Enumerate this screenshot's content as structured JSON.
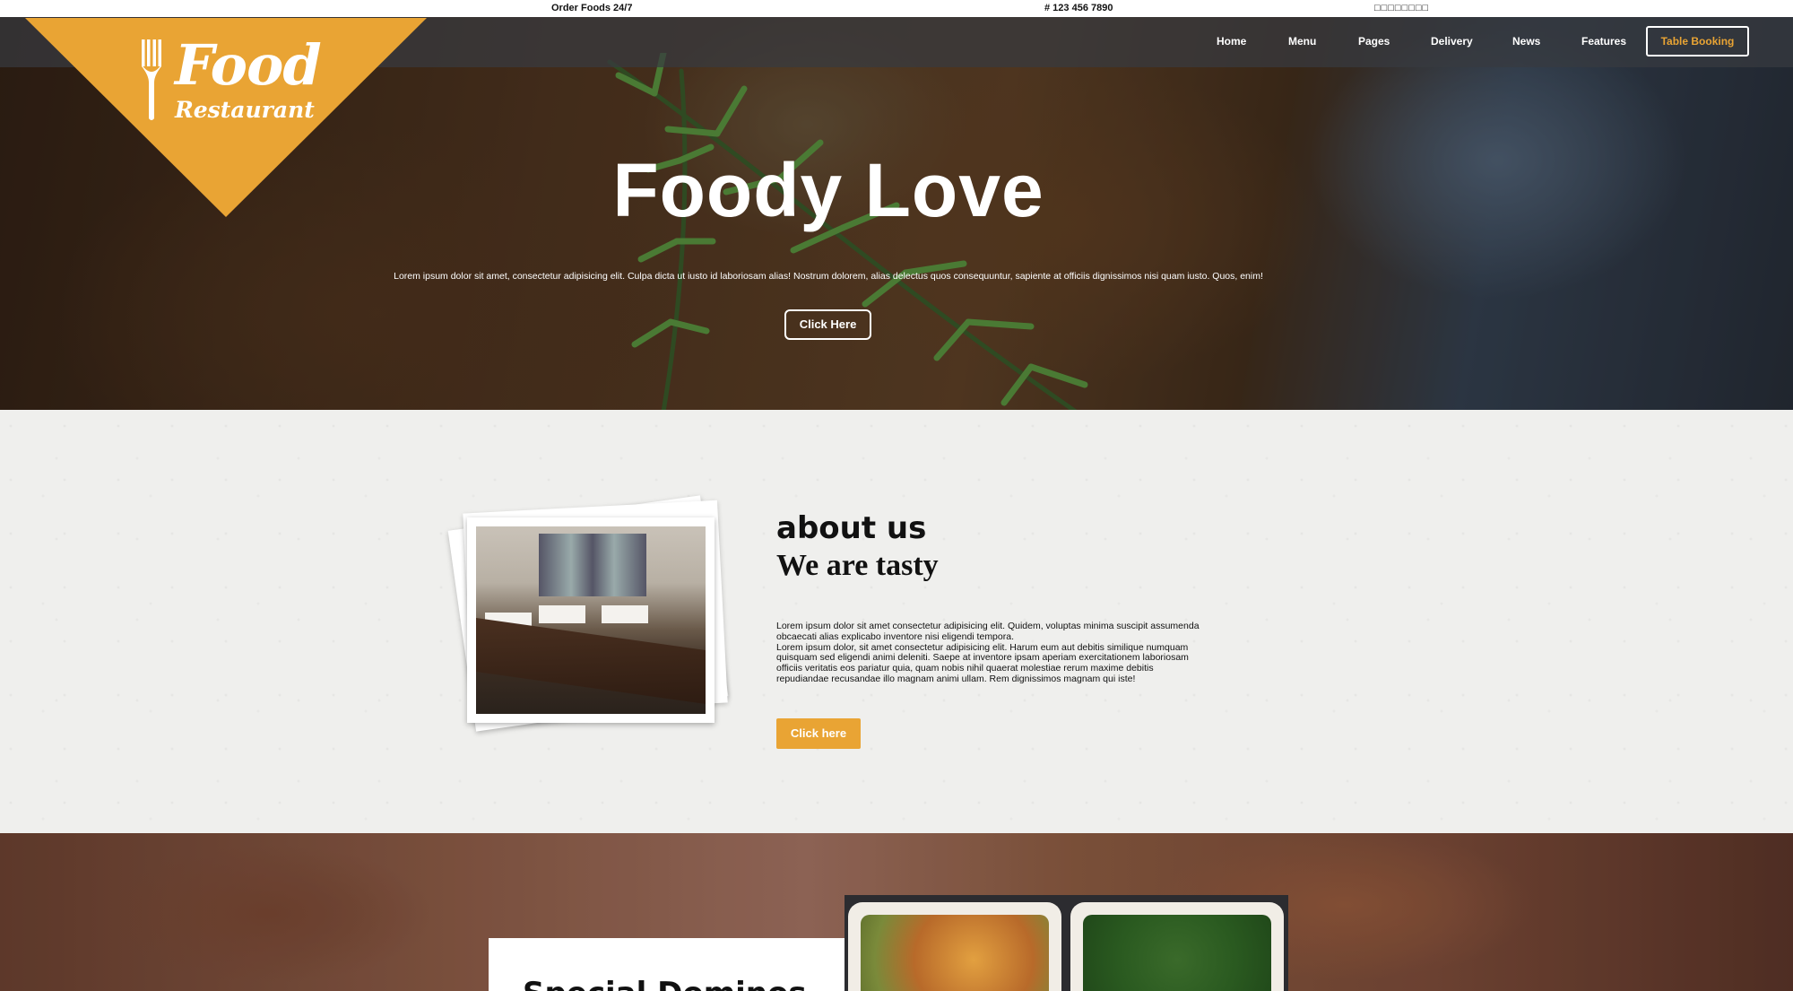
{
  "topbar": {
    "order": "Order Foods 24/7",
    "phone": "# 123 456 7890",
    "social": "□□□□□□□□"
  },
  "logo": {
    "line1": "Food",
    "line2": "Restaurant"
  },
  "nav": {
    "home": "Home",
    "menu": "Menu",
    "pages": "Pages",
    "delivery": "Delivery",
    "news": "News",
    "features": "Features",
    "booking": "Table Booking"
  },
  "hero": {
    "title": "Foody Love",
    "text": "Lorem ipsum dolor sit amet, consectetur adipisicing elit. Culpa dicta ut iusto id laboriosam alias! Nostrum dolorem, alias delectus quos consequuntur, sapiente at officiis dignissimos nisi quam iusto. Quos, enim!",
    "button": "Click Here"
  },
  "about": {
    "heading": "about us",
    "subheading": "We are tasty",
    "lines": [
      "Lorem ipsum dolor sit amet consectetur adipisicing elit. Quidem, voluptas minima suscipit assumenda",
      "obcaecati alias explicabo inventore nisi eligendi tempora.",
      "Lorem ipsum dolor, sit amet consectetur adipisicing elit. Harum eum aut debitis similique numquam",
      "quisquam sed eligendi animi deleniti. Saepe at inventore ipsam aperiam exercitationem laboriosam",
      "officiis veritatis eos pariatur quia, quam nobis nihil quaerat molestiae rerum maxime debitis",
      "repudiandae recusandae illo magnam animi ullam. Rem dignissimos magnam qui iste!"
    ],
    "button": "Click here"
  },
  "special": {
    "title": "Special Dominos"
  },
  "colors": {
    "accent": "#e9a434",
    "navbar": "#373a40"
  }
}
